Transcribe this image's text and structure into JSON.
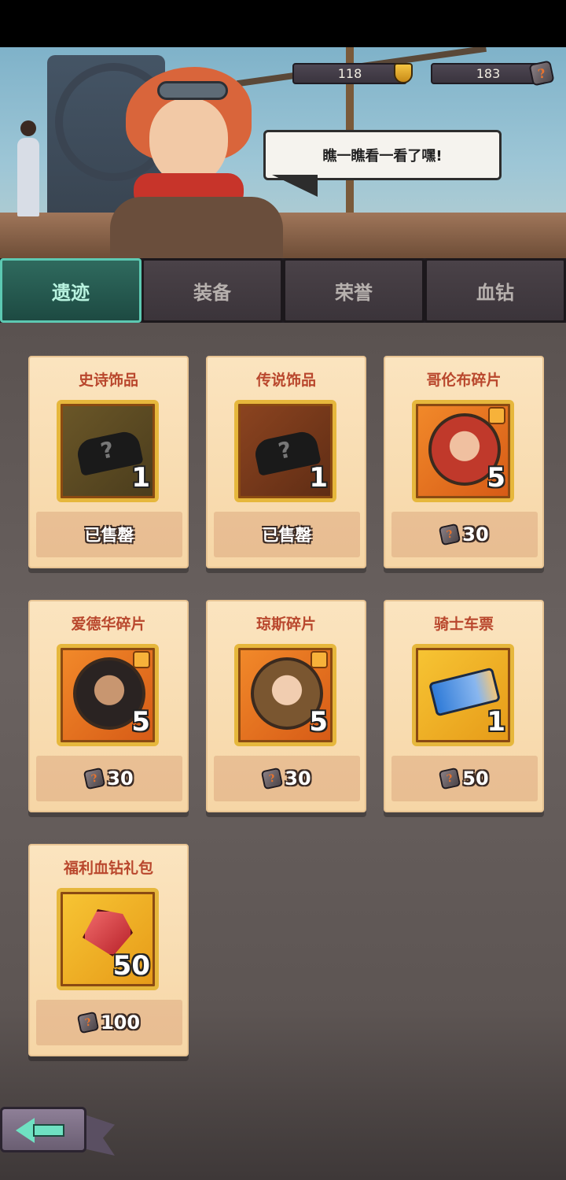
{
  "header": {
    "trophy_count": "118",
    "stone_count": "183",
    "speech": "瞧一瞧看一看了嘿!"
  },
  "tabs": [
    {
      "label": "遗迹",
      "active": true
    },
    {
      "label": "装备",
      "active": false
    },
    {
      "label": "荣誉",
      "active": false
    },
    {
      "label": "血钻",
      "active": false
    }
  ],
  "items": [
    {
      "title": "史诗饰品",
      "qty": "1",
      "price": "已售罄",
      "sold": true,
      "icon": "unknown-accessory-icon"
    },
    {
      "title": "传说饰品",
      "qty": "1",
      "price": "已售罄",
      "sold": true,
      "icon": "unknown-accessory-icon"
    },
    {
      "title": "哥伦布碎片",
      "qty": "5",
      "price": "30",
      "sold": false,
      "icon": "columbus-shard-icon"
    },
    {
      "title": "爱德华碎片",
      "qty": "5",
      "price": "30",
      "sold": false,
      "icon": "edward-shard-icon"
    },
    {
      "title": "琼斯碎片",
      "qty": "5",
      "price": "30",
      "sold": false,
      "icon": "jones-shard-icon"
    },
    {
      "title": "骑士车票",
      "qty": "1",
      "price": "50",
      "sold": false,
      "icon": "knight-ticket-icon"
    },
    {
      "title": "福利血钻礼包",
      "qty": "50",
      "price": "100",
      "sold": false,
      "icon": "blood-diamond-icon"
    }
  ],
  "colors": {
    "active_tab": "#2f6a5e",
    "accent": "#5cc9b2",
    "card_title": "#b9472d"
  }
}
